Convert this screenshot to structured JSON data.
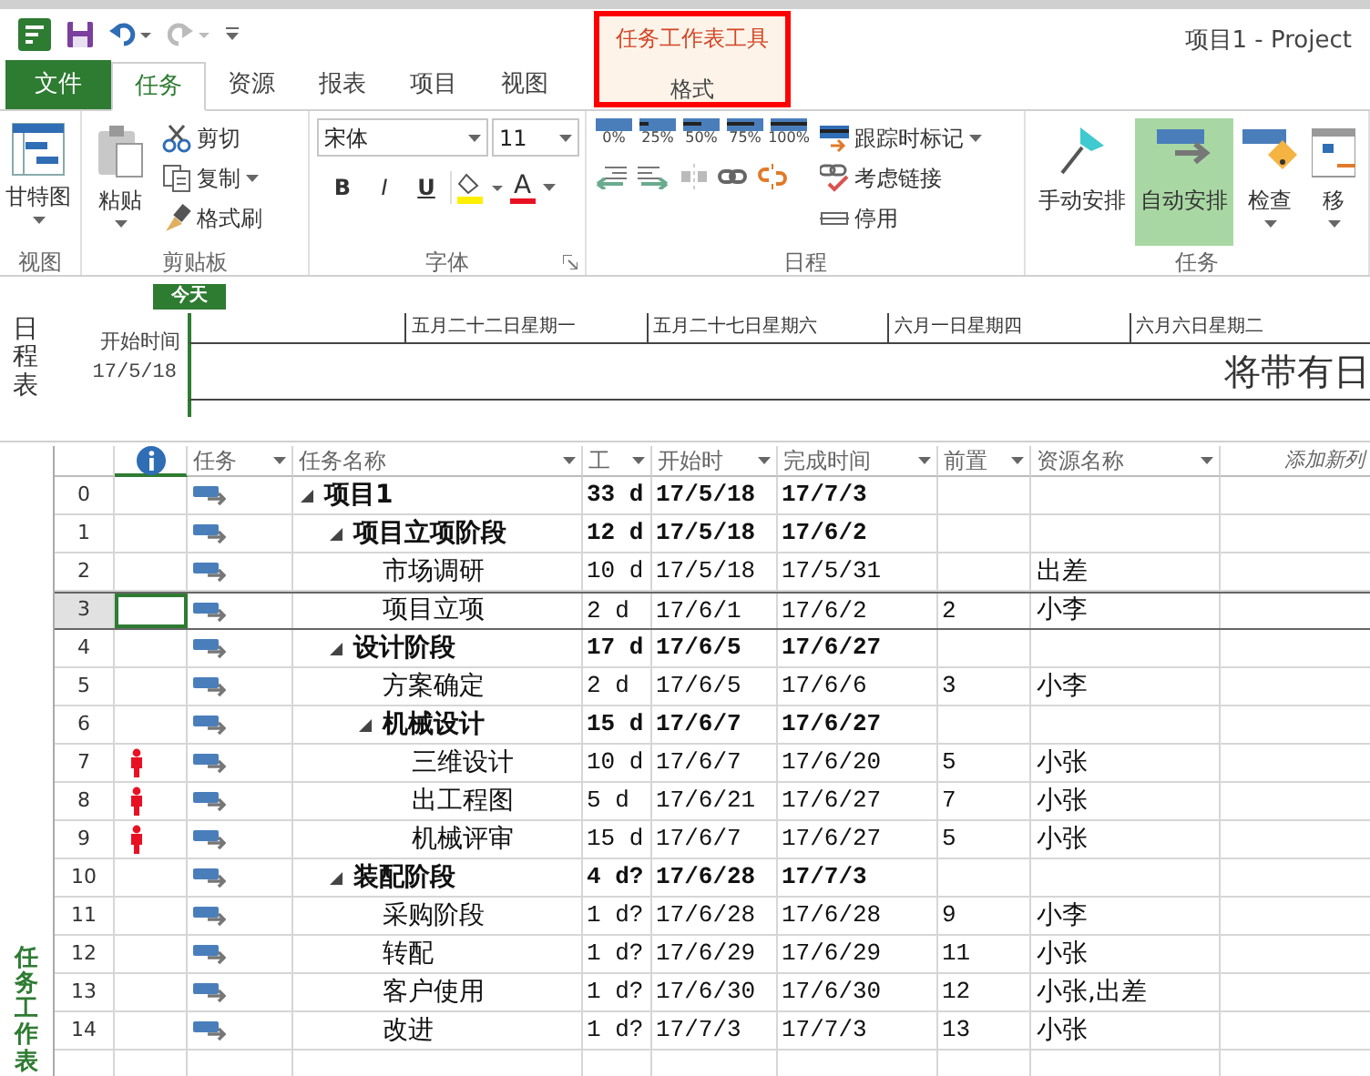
{
  "window": {
    "title": "项目1 - Project"
  },
  "contextual_tab": {
    "group": "任务工作表工具",
    "label": "格式"
  },
  "tabs": [
    {
      "label": "文件",
      "kind": "file",
      "selected": false
    },
    {
      "label": "任务",
      "kind": "tab",
      "selected": true
    },
    {
      "label": "资源",
      "kind": "tab",
      "selected": false
    },
    {
      "label": "报表",
      "kind": "tab",
      "selected": false
    },
    {
      "label": "项目",
      "kind": "tab",
      "selected": false
    },
    {
      "label": "视图",
      "kind": "tab",
      "selected": false
    }
  ],
  "ribbon": {
    "view": {
      "label": "视图",
      "gantt": "甘特图"
    },
    "clipboard": {
      "label": "剪贴板",
      "paste": "粘贴",
      "cut": "剪切",
      "copy": "复制",
      "format_painter": "格式刷"
    },
    "font": {
      "label": "字体",
      "font_name": "宋体",
      "font_size": "11",
      "bold": "B",
      "italic": "I",
      "underline": "U",
      "font_color": "A"
    },
    "schedule": {
      "label": "日程",
      "percent_buttons": [
        "0%",
        "25%",
        "50%",
        "75%",
        "100%"
      ],
      "mark_on_track": "跟踪时标记",
      "respect_links": "考虑链接",
      "inactivate": "停用"
    },
    "tasks": {
      "label": "任务",
      "modes": [
        {
          "label": "手动安排",
          "selected": false
        },
        {
          "label": "自动安排",
          "selected": true
        }
      ],
      "inspect": "检查",
      "move": "移"
    }
  },
  "timeline": {
    "label": "日程表",
    "today": "今天",
    "start_label": "开始时间",
    "start_date": "17/5/18",
    "ticks": [
      "五月二十二日星期一",
      "五月二十七日星期六",
      "六月一日星期四",
      "六月六日星期二"
    ],
    "placeholder": "将带有日"
  },
  "sheet_label": "任务工作表",
  "table": {
    "columns": [
      {
        "kind": "icon"
      },
      {
        "label": "任务",
        "filter": true
      },
      {
        "label": "任务名称",
        "filter": true
      },
      {
        "label": "工",
        "filter": true
      },
      {
        "label": "开始时",
        "filter": true
      },
      {
        "label": "完成时间",
        "filter": true
      },
      {
        "label": "前置",
        "filter": true
      },
      {
        "label": "资源名称",
        "filter": true
      },
      {
        "label": "添加新列",
        "filter": false
      }
    ],
    "rows": [
      {
        "id": "0",
        "name": "项目1",
        "duration": "33 d",
        "start": "17/5/18",
        "finish": "17/7/3",
        "expanded": true,
        "overallocated": false,
        "selected": false,
        "children": [
          {
            "id": "1",
            "name": "项目立项阶段",
            "duration": "12 d",
            "start": "17/5/18",
            "finish": "17/6/2",
            "expanded": true,
            "overallocated": false,
            "selected": false,
            "children": [
              {
                "id": "2",
                "name": "市场调研",
                "duration": "10 d",
                "start": "17/5/18",
                "finish": "17/5/31",
                "resource": "出差",
                "overallocated": false,
                "selected": false
              },
              {
                "id": "3",
                "name": "项目立项",
                "duration": "2 d",
                "start": "17/6/1",
                "finish": "17/6/2",
                "predecessors": "2",
                "resource": "小李",
                "overallocated": false,
                "selected": true
              }
            ]
          },
          {
            "id": "4",
            "name": "设计阶段",
            "duration": "17 d",
            "start": "17/6/5",
            "finish": "17/6/27",
            "expanded": true,
            "overallocated": false,
            "selected": false,
            "children": [
              {
                "id": "5",
                "name": "方案确定",
                "duration": "2 d",
                "start": "17/6/5",
                "finish": "17/6/6",
                "predecessors": "3",
                "resource": "小李",
                "overallocated": false,
                "selected": false
              },
              {
                "id": "6",
                "name": "机械设计",
                "duration": "15 d",
                "start": "17/6/7",
                "finish": "17/6/27",
                "expanded": true,
                "overallocated": false,
                "selected": false,
                "children": [
                  {
                    "id": "7",
                    "name": "三维设计",
                    "duration": "10 d",
                    "start": "17/6/7",
                    "finish": "17/6/20",
                    "predecessors": "5",
                    "resource": "小张",
                    "overallocated": true,
                    "selected": false
                  },
                  {
                    "id": "8",
                    "name": "出工程图",
                    "duration": "5 d",
                    "start": "17/6/21",
                    "finish": "17/6/27",
                    "predecessors": "7",
                    "resource": "小张",
                    "overallocated": true,
                    "selected": false
                  },
                  {
                    "id": "9",
                    "name": "机械评审",
                    "duration": "15 d",
                    "start": "17/6/7",
                    "finish": "17/6/27",
                    "predecessors": "5",
                    "resource": "小张",
                    "overallocated": true,
                    "selected": false
                  }
                ]
              }
            ]
          },
          {
            "id": "10",
            "name": "装配阶段",
            "duration": "4 d?",
            "start": "17/6/28",
            "finish": "17/7/3",
            "expanded": true,
            "overallocated": false,
            "selected": false,
            "children": [
              {
                "id": "11",
                "name": "采购阶段",
                "duration": "1 d?",
                "start": "17/6/28",
                "finish": "17/6/28",
                "predecessors": "9",
                "resource": "小李",
                "overallocated": false,
                "selected": false
              },
              {
                "id": "12",
                "name": "转配",
                "duration": "1 d?",
                "start": "17/6/29",
                "finish": "17/6/29",
                "predecessors": "11",
                "resource": "小张",
                "overallocated": false,
                "selected": false
              },
              {
                "id": "13",
                "name": "客户使用",
                "duration": "1 d?",
                "start": "17/6/30",
                "finish": "17/6/30",
                "predecessors": "12",
                "resource": "小张,出差",
                "overallocated": false,
                "selected": false
              },
              {
                "id": "14",
                "name": "改进",
                "duration": "1 d?",
                "start": "17/7/3",
                "finish": "17/7/3",
                "predecessors": "13",
                "resource": "小张",
                "overallocated": false,
                "selected": false
              }
            ]
          }
        ]
      }
    ]
  }
}
